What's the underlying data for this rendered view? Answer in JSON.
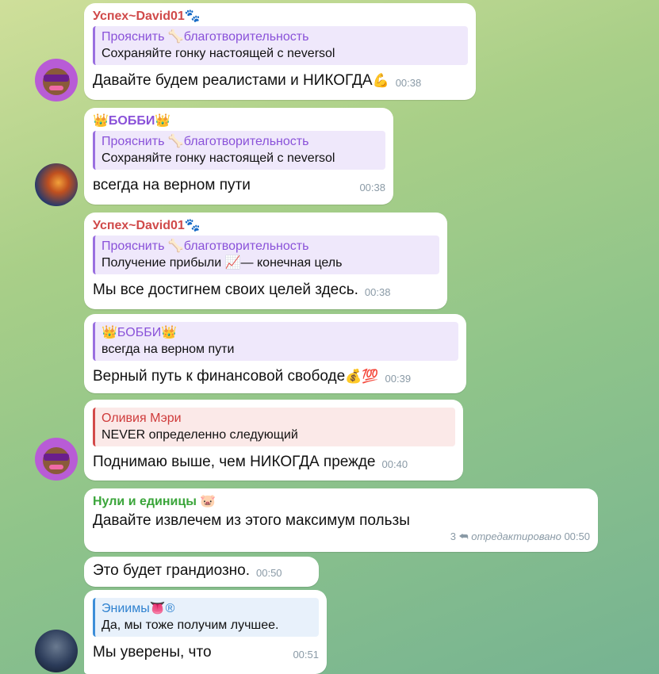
{
  "messages": [
    {
      "sender": "Успех~David01",
      "sender_emoji": "🐾",
      "sender_color": "#d04a4a",
      "quote": {
        "title": "Прояснить 🦴благотворительность",
        "body": "Сохраняйте гонку настоящей с neversol"
      },
      "text": "Давайте будем реалистами и НИКОГДА",
      "text_emoji": "💪",
      "time": "00:38"
    },
    {
      "sender": "👑БОББИ👑",
      "sender_color": "#8a52d9",
      "quote": {
        "title": "Прояснить 🦴благотворительность",
        "body": "Сохраняйте гонку настоящей с neversol"
      },
      "text": "всегда на верном пути",
      "time": "00:38"
    },
    {
      "sender": "Успех~David01",
      "sender_emoji": "🐾",
      "sender_color": "#d04a4a",
      "quote": {
        "title": "Прояснить 🦴благотворительность",
        "body": "Получение прибыли 📈— конечная цель"
      },
      "text": "Мы все достигнем своих целей здесь.",
      "time": "00:38"
    },
    {
      "quote": {
        "title": "👑БОББИ👑",
        "body": "всегда на верном пути"
      },
      "text": "Верный путь к финансовой свободе",
      "text_emoji": "💰💯",
      "time": "00:39"
    },
    {
      "quote": {
        "title": "Оливия Мэри",
        "body": "NEVER определенно следующий"
      },
      "text": "Поднимаю выше, чем НИКОГДА прежде",
      "time": "00:40"
    },
    {
      "sender": "Нули и единицы",
      "sender_emoji": "🐷",
      "sender_color": "#3aa53a",
      "text": "Давайте извлечем из этого максимум пользы",
      "replies": "3",
      "edited": "отредактировано",
      "time": "00:50"
    },
    {
      "text": "Это будет грандиозно.",
      "time": "00:50"
    },
    {
      "quote": {
        "title": "Эниимы👅®",
        "body": "Да, мы тоже получим лучшее."
      },
      "text": "Мы уверены, что",
      "time": "00:51"
    }
  ]
}
